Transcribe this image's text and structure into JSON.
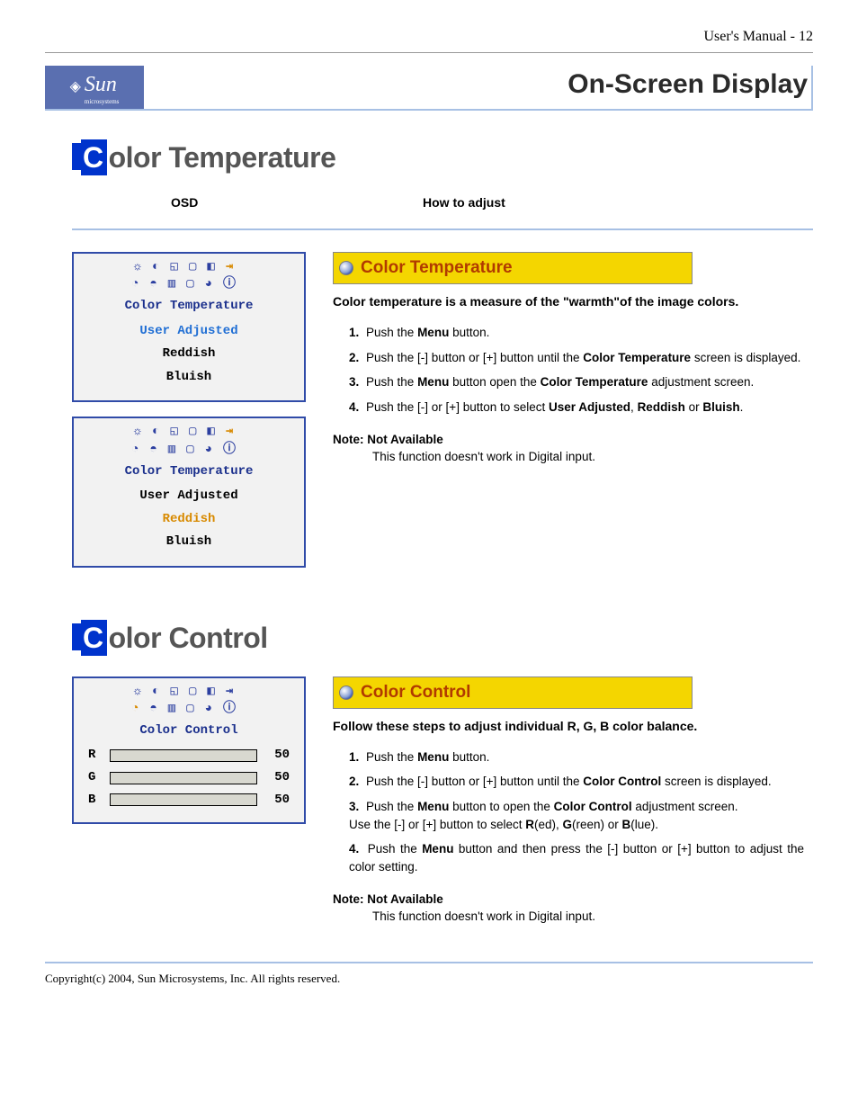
{
  "page_label": "User's Manual - 12",
  "brand": "Sun",
  "brand_sub": "microsystems",
  "header_title": "On-Screen Display",
  "cols": {
    "osd": "OSD",
    "howto": "How to adjust"
  },
  "sectionA": {
    "title_rest": "olor Temperature",
    "osd1": {
      "title": "Color Temperature",
      "opts": [
        "User Adjusted",
        "Reddish",
        "Bluish"
      ],
      "selected": "User Adjusted"
    },
    "osd2": {
      "title": "Color Temperature",
      "opts": [
        "User Adjusted",
        "Reddish",
        "Bluish"
      ],
      "selected": "Reddish"
    },
    "yellow": "Color Temperature",
    "intro": "Color temperature is a measure of the \"warmth\"of the image colors.",
    "steps": [
      {
        "n": "1.",
        "html": "Push the <b>Menu</b> button."
      },
      {
        "n": "2.",
        "html": "Push the [-] button or [+] button until the <b>Color Temperature</b> screen is displayed."
      },
      {
        "n": "3.",
        "html": "Push the <b>Menu</b> button open the <b>Color Temperature</b> adjustment screen."
      },
      {
        "n": "4.",
        "html": "Push the [-] or [+] button to select <b>User Adjusted</b>, <b>Reddish</b> or <b>Bluish</b>."
      }
    ],
    "note_head": "Note: Not Available",
    "note_body": "This function doesn't work in Digital input."
  },
  "sectionB": {
    "title_rest": "olor Control",
    "osd3": {
      "title": "Color Control",
      "rgb": [
        {
          "label": "R",
          "value": 50
        },
        {
          "label": "G",
          "value": 50
        },
        {
          "label": "B",
          "value": 50
        }
      ]
    },
    "yellow": "Color Control",
    "intro": "Follow these steps to adjust individual R, G, B color balance.",
    "steps": [
      {
        "n": "1.",
        "html": "Push the <b>Menu</b> button."
      },
      {
        "n": "2.",
        "html": "Push the [-] button or [+] button until the <b>Color Control</b> screen is displayed."
      },
      {
        "n": "3.",
        "html": "Push the <b>Menu</b> button to open the <b>Color Control</b> adjustment screen.<br>Use the [-] or [+] button to select <b>R</b>(ed), <b>G</b>(reen) or <b>B</b>(lue)."
      },
      {
        "n": "4.",
        "html": "Push the <b>Menu</b> button and then press the [-] button or [+] button to adjust the color setting."
      }
    ],
    "note_head": "Note: Not Available",
    "note_body": "This function doesn't work in Digital input."
  },
  "footer": "Copyright(c) 2004, Sun Microsystems, Inc. All rights reserved."
}
